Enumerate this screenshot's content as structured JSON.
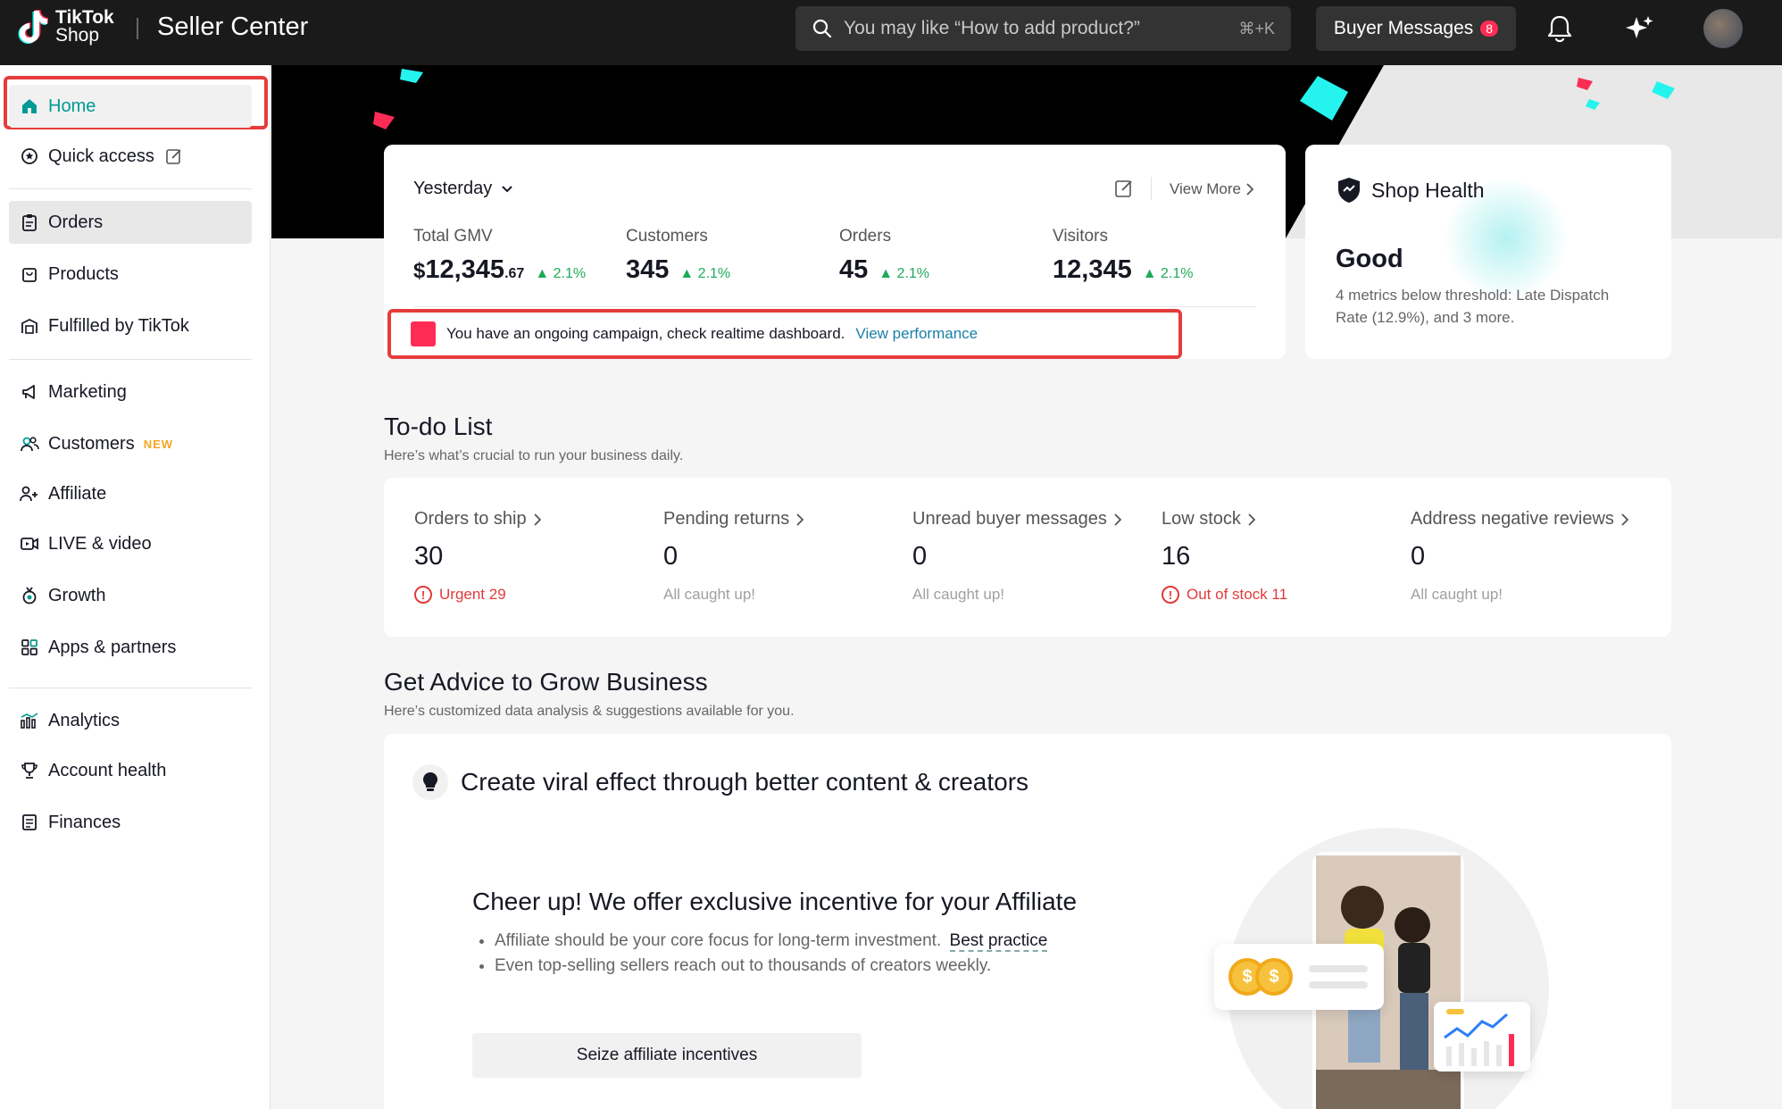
{
  "header": {
    "logo_line1": "TikTok",
    "logo_line2": "Shop",
    "app_title": "Seller Center",
    "search_placeholder": "You may like “How to add product?”",
    "search_shortcut": "⌘+K",
    "buyer_messages_label": "Buyer Messages",
    "buyer_messages_count": "8"
  },
  "sidebar": {
    "items": [
      {
        "label": "Home",
        "icon": "home-icon"
      },
      {
        "label": "Quick access",
        "icon": "star-circle-icon"
      },
      {
        "label": "Orders",
        "icon": "clipboard-icon"
      },
      {
        "label": "Products",
        "icon": "bag-icon"
      },
      {
        "label": "Fulfilled by TikTok",
        "icon": "warehouse-icon"
      },
      {
        "label": "Marketing",
        "icon": "megaphone-icon"
      },
      {
        "label": "Customers",
        "icon": "users-icon",
        "tag": "NEW"
      },
      {
        "label": "Affiliate",
        "icon": "affiliate-icon"
      },
      {
        "label": "LIVE & video",
        "icon": "video-icon"
      },
      {
        "label": "Growth",
        "icon": "medal-icon"
      },
      {
        "label": "Apps & partners",
        "icon": "apps-icon"
      },
      {
        "label": "Analytics",
        "icon": "chart-icon"
      },
      {
        "label": "Account health",
        "icon": "trophy-icon"
      },
      {
        "label": "Finances",
        "icon": "finance-icon"
      }
    ]
  },
  "metrics": {
    "period": "Yesterday",
    "view_more": "View More",
    "items": [
      {
        "label": "Total GMV",
        "prefix": "$",
        "value": "12,345",
        "decimal": ".67",
        "change": "2.1%"
      },
      {
        "label": "Customers",
        "prefix": "",
        "value": "345",
        "decimal": "",
        "change": "2.1%"
      },
      {
        "label": "Orders",
        "prefix": "",
        "value": "45",
        "decimal": "",
        "change": "2.1%"
      },
      {
        "label": "Visitors",
        "prefix": "",
        "value": "12,345",
        "decimal": "",
        "change": "2.1%"
      }
    ],
    "campaign_text": "You have an ongoing campaign, check realtime dashboard.",
    "campaign_link": "View performance"
  },
  "shop_health": {
    "title": "Shop Health",
    "status": "Good",
    "description": "4 metrics below threshold: Late Dispatch Rate (12.9%), and 3 more."
  },
  "todo": {
    "title": "To-do List",
    "subtitle": "Here’s what’s crucial to run your business daily.",
    "items": [
      {
        "label": "Orders to ship",
        "value": "30",
        "note": "Urgent 29",
        "alert": true
      },
      {
        "label": "Pending returns",
        "value": "0",
        "note": "All caught up!",
        "alert": false
      },
      {
        "label": "Unread buyer messages",
        "value": "0",
        "note": "All caught up!",
        "alert": false
      },
      {
        "label": "Low stock",
        "value": "16",
        "note": "Out of stock 11",
        "alert": true
      },
      {
        "label": "Address negative reviews",
        "value": "0",
        "note": "All caught up!",
        "alert": false
      }
    ]
  },
  "advice": {
    "title": "Get Advice to Grow Business",
    "subtitle": "Here’s customized data analysis & suggestions available for you.",
    "card_title": "Create viral effect through better content & creators",
    "headline": "Cheer up! We offer exclusive incentive for your Affiliate",
    "bullet1": "Affiliate should be your core focus for long-term investment.",
    "bullet1_link": "Best practice",
    "bullet2": "Even top-selling sellers reach out to thousands of creators weekly.",
    "cta": "Seize affiliate incentives"
  },
  "colors": {
    "accent": "#009995",
    "highlight_red": "#e63c3c",
    "positive": "#1faa5a",
    "alert": "#e23a3a"
  }
}
